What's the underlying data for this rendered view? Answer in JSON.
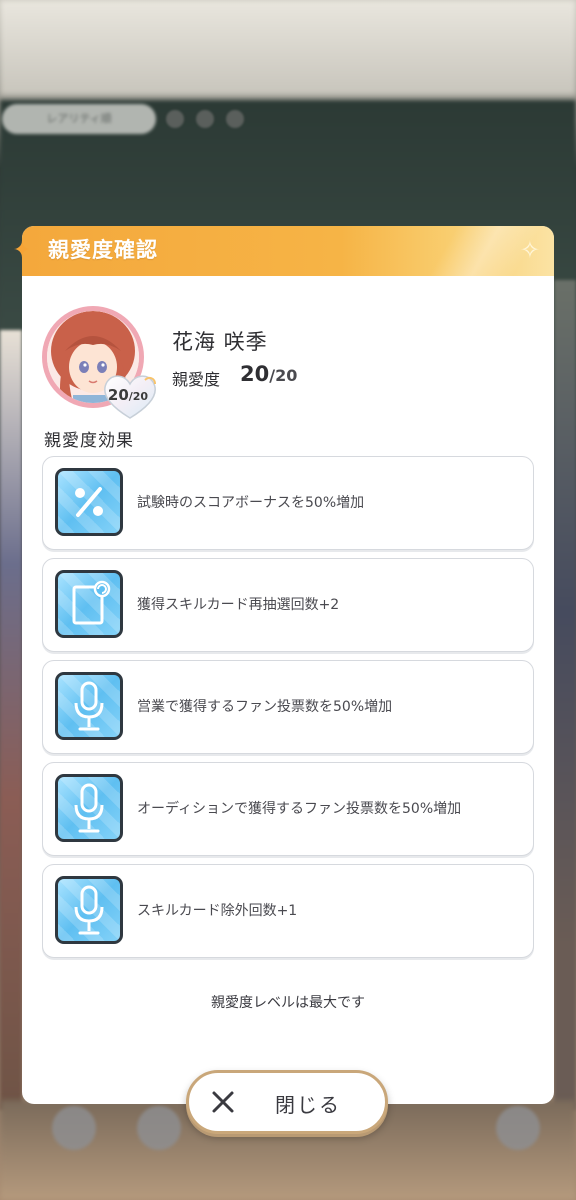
{
  "background": {
    "top_pill_label": "レアリティ順"
  },
  "dialog": {
    "title": "親愛度確認",
    "character": {
      "name": "花海 咲季",
      "affection_label": "親愛度",
      "affection_value": "20",
      "affection_max": "/20",
      "badge_value": "20",
      "badge_max": "/20"
    },
    "effects_title": "親愛度効果",
    "effects": [
      {
        "icon": "percent-icon",
        "text": "試験時のスコアボーナスを50%増加"
      },
      {
        "icon": "card-refresh-icon",
        "text": "獲得スキルカード再抽選回数+2"
      },
      {
        "icon": "microphone-icon",
        "text": "営業で獲得するファン投票数を50%増加"
      },
      {
        "icon": "microphone-icon",
        "text": "オーディションで獲得するファン投票数を50%増加"
      },
      {
        "icon": "microphone-icon",
        "text": "スキルカード除外回数+1"
      }
    ],
    "footer_note": "親愛度レベルは最大です",
    "close_label": "閉じる"
  },
  "colors": {
    "header_orange": "#f4a83c",
    "icon_blue": "#5fbff1",
    "card_border": "#d6d9de"
  }
}
